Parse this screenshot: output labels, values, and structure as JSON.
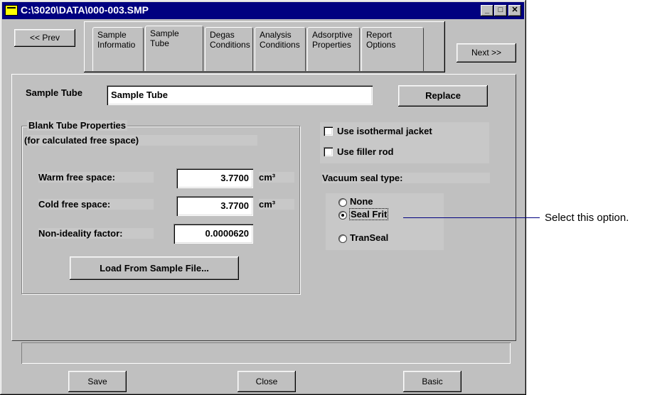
{
  "window": {
    "title": "C:\\3020\\DATA\\000-003.SMP"
  },
  "nav": {
    "prev_label": "<< Prev",
    "next_label": "Next >>"
  },
  "tabs": [
    {
      "line1": "Sample",
      "line2": "Informatio"
    },
    {
      "line1": "Sample",
      "line2": "Tube"
    },
    {
      "line1": "Degas",
      "line2": "Conditions"
    },
    {
      "line1": "Analysis",
      "line2": "Conditions"
    },
    {
      "line1": "Adsorptive",
      "line2": "Properties"
    },
    {
      "line1": "Report",
      "line2": "Options"
    }
  ],
  "sample_tube": {
    "label": "Sample Tube",
    "value": "Sample Tube",
    "replace_label": "Replace"
  },
  "blank_tube": {
    "group_title": "Blank Tube Properties",
    "subtitle": "(for calculated free space)",
    "warm_label": "Warm free space:",
    "warm_value": "3.7700",
    "warm_unit": "cm³",
    "cold_label": "Cold free space:",
    "cold_value": "3.7700",
    "cold_unit": "cm³",
    "nonideal_label": "Non-ideality factor:",
    "nonideal_value": "0.0000620",
    "load_label": "Load From Sample File..."
  },
  "options": {
    "isothermal_label": "Use isothermal jacket",
    "isothermal_checked": false,
    "filler_label": "Use filler rod",
    "filler_checked": false,
    "vacuum_label": "Vacuum seal type:",
    "radios": [
      {
        "label": "None",
        "selected": false
      },
      {
        "label": "Seal Frit",
        "selected": true
      },
      {
        "label": "TranSeal",
        "selected": false
      }
    ]
  },
  "footer": {
    "save_label": "Save",
    "close_label": "Close",
    "basic_label": "Basic"
  },
  "callout": {
    "text": "Select this option."
  }
}
